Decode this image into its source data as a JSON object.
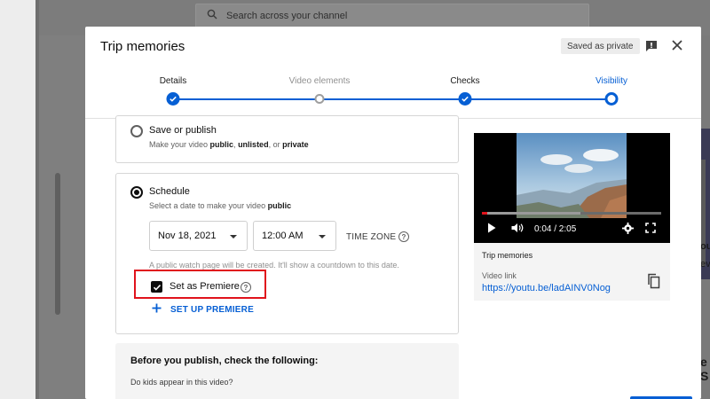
{
  "background": {
    "search_placeholder": "Search across your channel",
    "right_snippets": [
      "ou",
      "ev",
      "e S"
    ]
  },
  "dialog": {
    "title": "Trip memories",
    "saved_badge": "Saved as private"
  },
  "steps": [
    {
      "label": "Details",
      "state": "done"
    },
    {
      "label": "Video elements",
      "state": "inactive"
    },
    {
      "label": "Checks",
      "state": "done"
    },
    {
      "label": "Visibility",
      "state": "current"
    }
  ],
  "save_or_publish": {
    "title": "Save or publish",
    "subtitle_prefix": "Make your video ",
    "opt_public": "public",
    "sep1": ", ",
    "opt_unlisted": "unlisted",
    "sep2": ", or ",
    "opt_private": "private",
    "selected": false
  },
  "schedule": {
    "title": "Schedule",
    "subtitle_prefix": "Select a date to make your video ",
    "subtitle_bold": "public",
    "selected": true,
    "date_value": "Nov 18, 2021",
    "time_value": "12:00 AM",
    "timezone_label": "TIME ZONE",
    "info_text": "A public watch page will be created. It'll show a countdown to this date.",
    "premiere_label": "Set as Premiere",
    "premiere_checked": true,
    "setup_label": "SET UP PREMIERE"
  },
  "checks": {
    "title": "Before you publish, check the following:",
    "question": "Do kids appear in this video?"
  },
  "preview": {
    "time": "0:04 / 2:05",
    "progress_fraction": 0.032,
    "buffered_fraction": 0.55,
    "title": "Trip memories",
    "link_label": "Video link",
    "link": "https://youtu.be/ladAINV0Nog"
  },
  "colors": {
    "accent": "#065fd4",
    "highlight": "#e0131c"
  }
}
